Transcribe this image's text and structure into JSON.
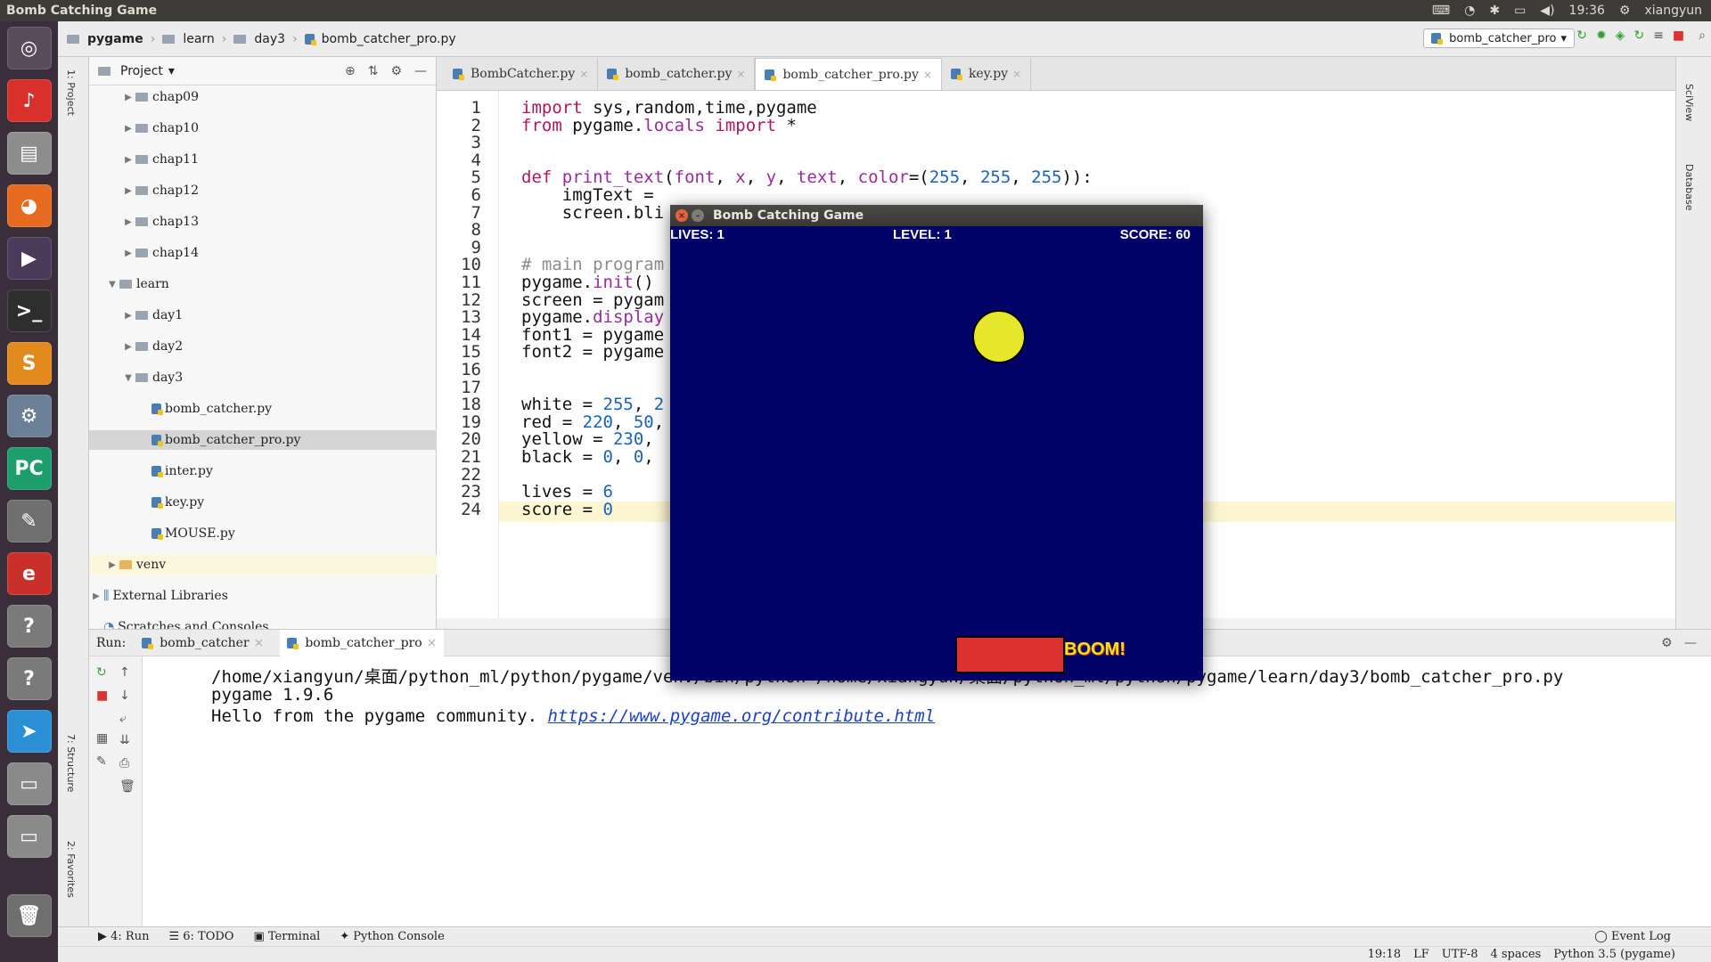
{
  "topbar": {
    "title": "Bomb Catching Game",
    "time": "19:36",
    "user": "xiangyun"
  },
  "breadcrumb": [
    "pygame",
    "learn",
    "day3",
    "bomb_catcher_pro.py"
  ],
  "run_config": "bomb_catcher_pro",
  "project": {
    "title": "Project",
    "items": [
      {
        "label": "chap09",
        "level": 2,
        "kind": "folder",
        "expanded": false
      },
      {
        "label": "chap10",
        "level": 2,
        "kind": "folder",
        "expanded": false
      },
      {
        "label": "chap11",
        "level": 2,
        "kind": "folder",
        "expanded": false
      },
      {
        "label": "chap12",
        "level": 2,
        "kind": "folder",
        "expanded": false
      },
      {
        "label": "chap13",
        "level": 2,
        "kind": "folder",
        "expanded": false
      },
      {
        "label": "chap14",
        "level": 2,
        "kind": "folder",
        "expanded": false
      },
      {
        "label": "learn",
        "level": 1,
        "kind": "folder",
        "expanded": true
      },
      {
        "label": "day1",
        "level": 2,
        "kind": "folder",
        "expanded": false
      },
      {
        "label": "day2",
        "level": 2,
        "kind": "folder",
        "expanded": false
      },
      {
        "label": "day3",
        "level": 2,
        "kind": "folder",
        "expanded": true
      },
      {
        "label": "bomb_catcher.py",
        "level": 3,
        "kind": "py"
      },
      {
        "label": "bomb_catcher_pro.py",
        "level": 3,
        "kind": "py",
        "selected": true
      },
      {
        "label": "inter.py",
        "level": 3,
        "kind": "py"
      },
      {
        "label": "key.py",
        "level": 3,
        "kind": "py"
      },
      {
        "label": "MOUSE.py",
        "level": 3,
        "kind": "py"
      },
      {
        "label": "venv",
        "level": 1,
        "kind": "folder-orange",
        "expanded": false
      },
      {
        "label": "External Libraries",
        "level": 0,
        "kind": "lib",
        "expanded": false
      },
      {
        "label": "Scratches and Consoles",
        "level": 0,
        "kind": "scratch"
      }
    ]
  },
  "tabs": [
    "BombCatcher.py",
    "bomb_catcher.py",
    "bomb_catcher_pro.py",
    "key.py"
  ],
  "active_tab": 2,
  "code": [
    {
      "n": "1",
      "t": "import sys,random,time,pygame"
    },
    {
      "n": "2",
      "t": "from pygame.locals import *"
    },
    {
      "n": "3",
      "t": ""
    },
    {
      "n": "4",
      "t": ""
    },
    {
      "n": "5",
      "t": "def print_text(font, x, y, text, color=(255, 255, 255)):"
    },
    {
      "n": "6",
      "t": "    imgText ="
    },
    {
      "n": "7",
      "t": "    screen.bli"
    },
    {
      "n": "8",
      "t": ""
    },
    {
      "n": "9",
      "t": ""
    },
    {
      "n": "10",
      "t": "# main program"
    },
    {
      "n": "11",
      "t": "pygame.init()"
    },
    {
      "n": "12",
      "t": "screen = pygam"
    },
    {
      "n": "13",
      "t": "pygame.display"
    },
    {
      "n": "14",
      "t": "font1 = pygame"
    },
    {
      "n": "15",
      "t": "font2 = pygame"
    },
    {
      "n": "16",
      "t": ""
    },
    {
      "n": "17",
      "t": ""
    },
    {
      "n": "18",
      "t": "white = 255, 2"
    },
    {
      "n": "19",
      "t": "red = 220, 50,"
    },
    {
      "n": "20",
      "t": "yellow = 230,"
    },
    {
      "n": "21",
      "t": "black = 0, 0,"
    },
    {
      "n": "22",
      "t": ""
    },
    {
      "n": "23",
      "t": "lives = 6"
    },
    {
      "n": "24",
      "t": "score = 0"
    }
  ],
  "run": {
    "label": "Run:",
    "tabs": [
      "bomb_catcher",
      "bomb_catcher_pro"
    ],
    "output": [
      "/home/xiangyun/桌面/python_ml/python/pygame/venv/bin/python /home/xiangyun/桌面/python_ml/python/pygame/learn/day3/bomb_catcher_pro.py",
      "pygame 1.9.6"
    ],
    "hello_prefix": "Hello from the pygame community. ",
    "hello_link": "https://www.pygame.org/contribute.html"
  },
  "toolwindows": [
    "4: Run",
    "6: TODO",
    "Terminal",
    "Python Console"
  ],
  "event_log": "Event Log",
  "status": [
    "19:18",
    "LF",
    "UTF-8",
    "4 spaces",
    "Python 3.5 (pygame)"
  ],
  "game": {
    "title": "Bomb Catching Game",
    "lives": "LIVES: 1",
    "level": "LEVEL: 1",
    "score": "SCORE: 60",
    "boom": "BOOM!",
    "bg_color": "#000066",
    "ball_color": "#e6e62a",
    "paddle_color": "#dc3232"
  }
}
